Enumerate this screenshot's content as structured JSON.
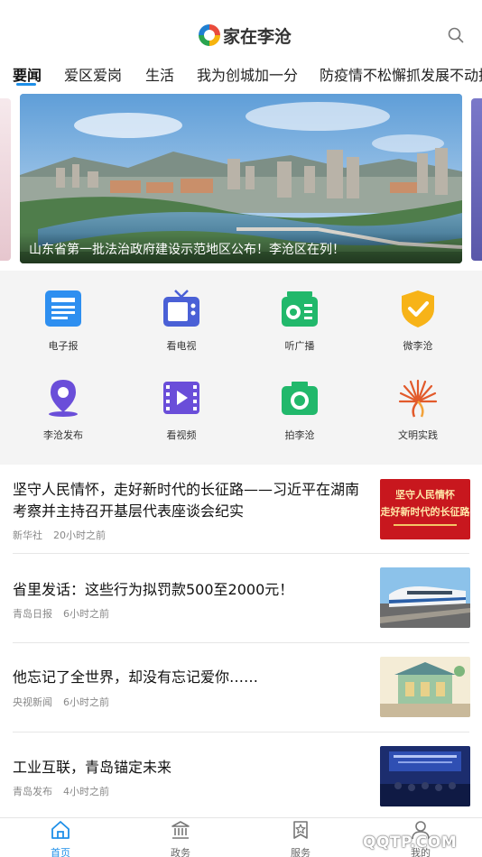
{
  "header": {
    "app_title": "家在李沧",
    "search_icon": "search-icon"
  },
  "tabs": [
    {
      "label": "要闻",
      "active": true
    },
    {
      "label": "爱区爱岗"
    },
    {
      "label": "生活"
    },
    {
      "label": "我为创城加一分"
    },
    {
      "label": "防疫情不松懈抓发展不动摇"
    }
  ],
  "banner": {
    "caption": "山东省第一批法治政府建设示范地区公布！李沧区在列！"
  },
  "services": [
    {
      "label": "电子报",
      "icon": "newspaper-icon"
    },
    {
      "label": "看电视",
      "icon": "tv-icon"
    },
    {
      "label": "听广播",
      "icon": "radio-icon"
    },
    {
      "label": "微李沧",
      "icon": "shield-check-icon"
    },
    {
      "label": "李沧发布",
      "icon": "location-pin-icon"
    },
    {
      "label": "看视频",
      "icon": "video-icon"
    },
    {
      "label": "拍李沧",
      "icon": "camera-icon"
    },
    {
      "label": "文明实践",
      "icon": "civilization-logo-icon"
    }
  ],
  "news": [
    {
      "title": "坚守人民情怀，走好新时代的长征路——习近平在湖南考察并主持召开基层代表座谈会纪实",
      "source": "新华社",
      "time": "20小时之前",
      "thumb_text_1": "坚守人民情怀",
      "thumb_text_2": "走好新时代的长征路"
    },
    {
      "title": "省里发话：这些行为拟罚款500至2000元！",
      "source": "青岛日报",
      "time": "6小时之前"
    },
    {
      "title": "他忘记了全世界，却没有忘记爱你……",
      "source": "央视新闻",
      "time": "6小时之前"
    },
    {
      "title": "工业互联，青岛锚定未来",
      "source": "青岛发布",
      "time": "4小时之前"
    }
  ],
  "bottom_nav": [
    {
      "label": "首页",
      "icon": "home-icon",
      "active": true
    },
    {
      "label": "政务",
      "icon": "government-icon"
    },
    {
      "label": "服务",
      "icon": "star-bookmark-icon"
    },
    {
      "label": "我的",
      "icon": "user-icon"
    }
  ],
  "watermark": "QQTP.COM",
  "colors": {
    "accent": "#1e8fe8",
    "grid_bg": "#f4f4f4",
    "meta_text": "#888888"
  }
}
